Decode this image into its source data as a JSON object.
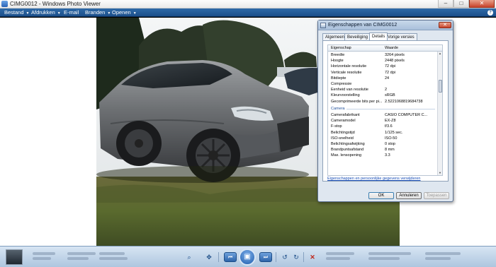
{
  "window": {
    "title": "CIMG0012 - Windows Photo Viewer",
    "min_glyph": "–",
    "max_glyph": "□",
    "close_glyph": "✕"
  },
  "menu": {
    "items": [
      {
        "label": "Bestand"
      },
      {
        "label": "Afdrukken"
      },
      {
        "label": "E-mail"
      },
      {
        "label": "Branden"
      },
      {
        "label": "Openen"
      }
    ],
    "caret": "▼",
    "help_glyph": "?"
  },
  "dialog": {
    "title": "Eigenschappen van CIMG0012",
    "close_glyph": "✕",
    "tabs": [
      {
        "label": "Algemeen"
      },
      {
        "label": "Beveiliging"
      },
      {
        "label": "Details"
      },
      {
        "label": "Vorige versies"
      }
    ],
    "active_tab": "Details",
    "columns": {
      "property": "Eigenschap",
      "value": "Waarde"
    },
    "rows_image": [
      {
        "k": "Breedte",
        "v": "3264 pixels"
      },
      {
        "k": "Hoogte",
        "v": "2448 pixels"
      },
      {
        "k": "Horizontale resolutie",
        "v": "72 dpi"
      },
      {
        "k": "Verticale resolutie",
        "v": "72 dpi"
      },
      {
        "k": "Bitdiepte",
        "v": "24"
      },
      {
        "k": "Compressie",
        "v": ""
      },
      {
        "k": "Eenheid van resolutie",
        "v": "2"
      },
      {
        "k": "Kleurvoorstelling",
        "v": "sRGB"
      },
      {
        "k": "Gecomprimeerde bits per pi...",
        "v": "2.5221068819684738"
      }
    ],
    "group_camera": "Camera",
    "rows_camera": [
      {
        "k": "Camerafabrikant",
        "v": "CASIO COMPUTER C..."
      },
      {
        "k": "Cameramodel",
        "v": "EX-Z8"
      },
      {
        "k": "F-stop",
        "v": "f/3.6"
      },
      {
        "k": "Belichtingstijd",
        "v": "1/125 sec."
      },
      {
        "k": "ISO-snelheid",
        "v": "ISO-50"
      },
      {
        "k": "Belichtingsafwijking",
        "v": "0 stop"
      },
      {
        "k": "Brandpuntsafstand",
        "v": "8 mm"
      },
      {
        "k": "Max. lensopening",
        "v": "3.3"
      }
    ],
    "remove_link": "Eigenschappen en persoonlijke gegevens verwijderen",
    "buttons": {
      "ok": "OK",
      "cancel": "Annuleren",
      "apply": "Toepassen"
    }
  },
  "toolbar": {
    "zoom_glyph": "⌕",
    "fit_glyph": "✥",
    "prev_glyph": "⏮",
    "slideshow_glyph": "▣",
    "next_glyph": "⏭",
    "rotate_ccw_glyph": "↺",
    "rotate_cw_glyph": "↻",
    "delete_glyph": "✕"
  },
  "colors": {
    "menubar": "#1b4f8a",
    "dialog_bg": "#dfe7f0",
    "link": "#1a4fb8",
    "delete": "#c0281b"
  }
}
